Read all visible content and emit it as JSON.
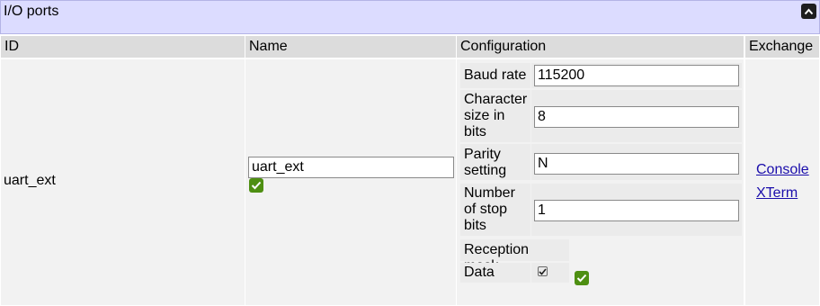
{
  "panel": {
    "title": "I/O ports"
  },
  "table": {
    "headers": {
      "id": "ID",
      "name": "Name",
      "configuration": "Configuration",
      "exchange": "Exchange"
    },
    "row": {
      "id": "uart_ext",
      "name_value": "uart_ext",
      "configuration": {
        "baud_rate": {
          "label": "Baud rate",
          "value": "115200"
        },
        "char_size": {
          "label_lines": [
            "Character",
            "size in",
            "bits"
          ],
          "value": "8"
        },
        "parity": {
          "label_lines": [
            "Parity",
            "setting"
          ],
          "value": "N"
        },
        "stop_bits": {
          "label_lines": [
            "Number",
            "of stop",
            "bits"
          ],
          "value": "1"
        },
        "reception_mask": {
          "label": "Reception mask"
        },
        "data": {
          "label": "Data",
          "checked": true
        }
      },
      "exchange": {
        "console": "Console",
        "xterm": "XTerm"
      }
    }
  },
  "colors": {
    "header_bg": "#dcdcff",
    "confirm_green": "#4e8f12",
    "link": "#1a0dab"
  }
}
